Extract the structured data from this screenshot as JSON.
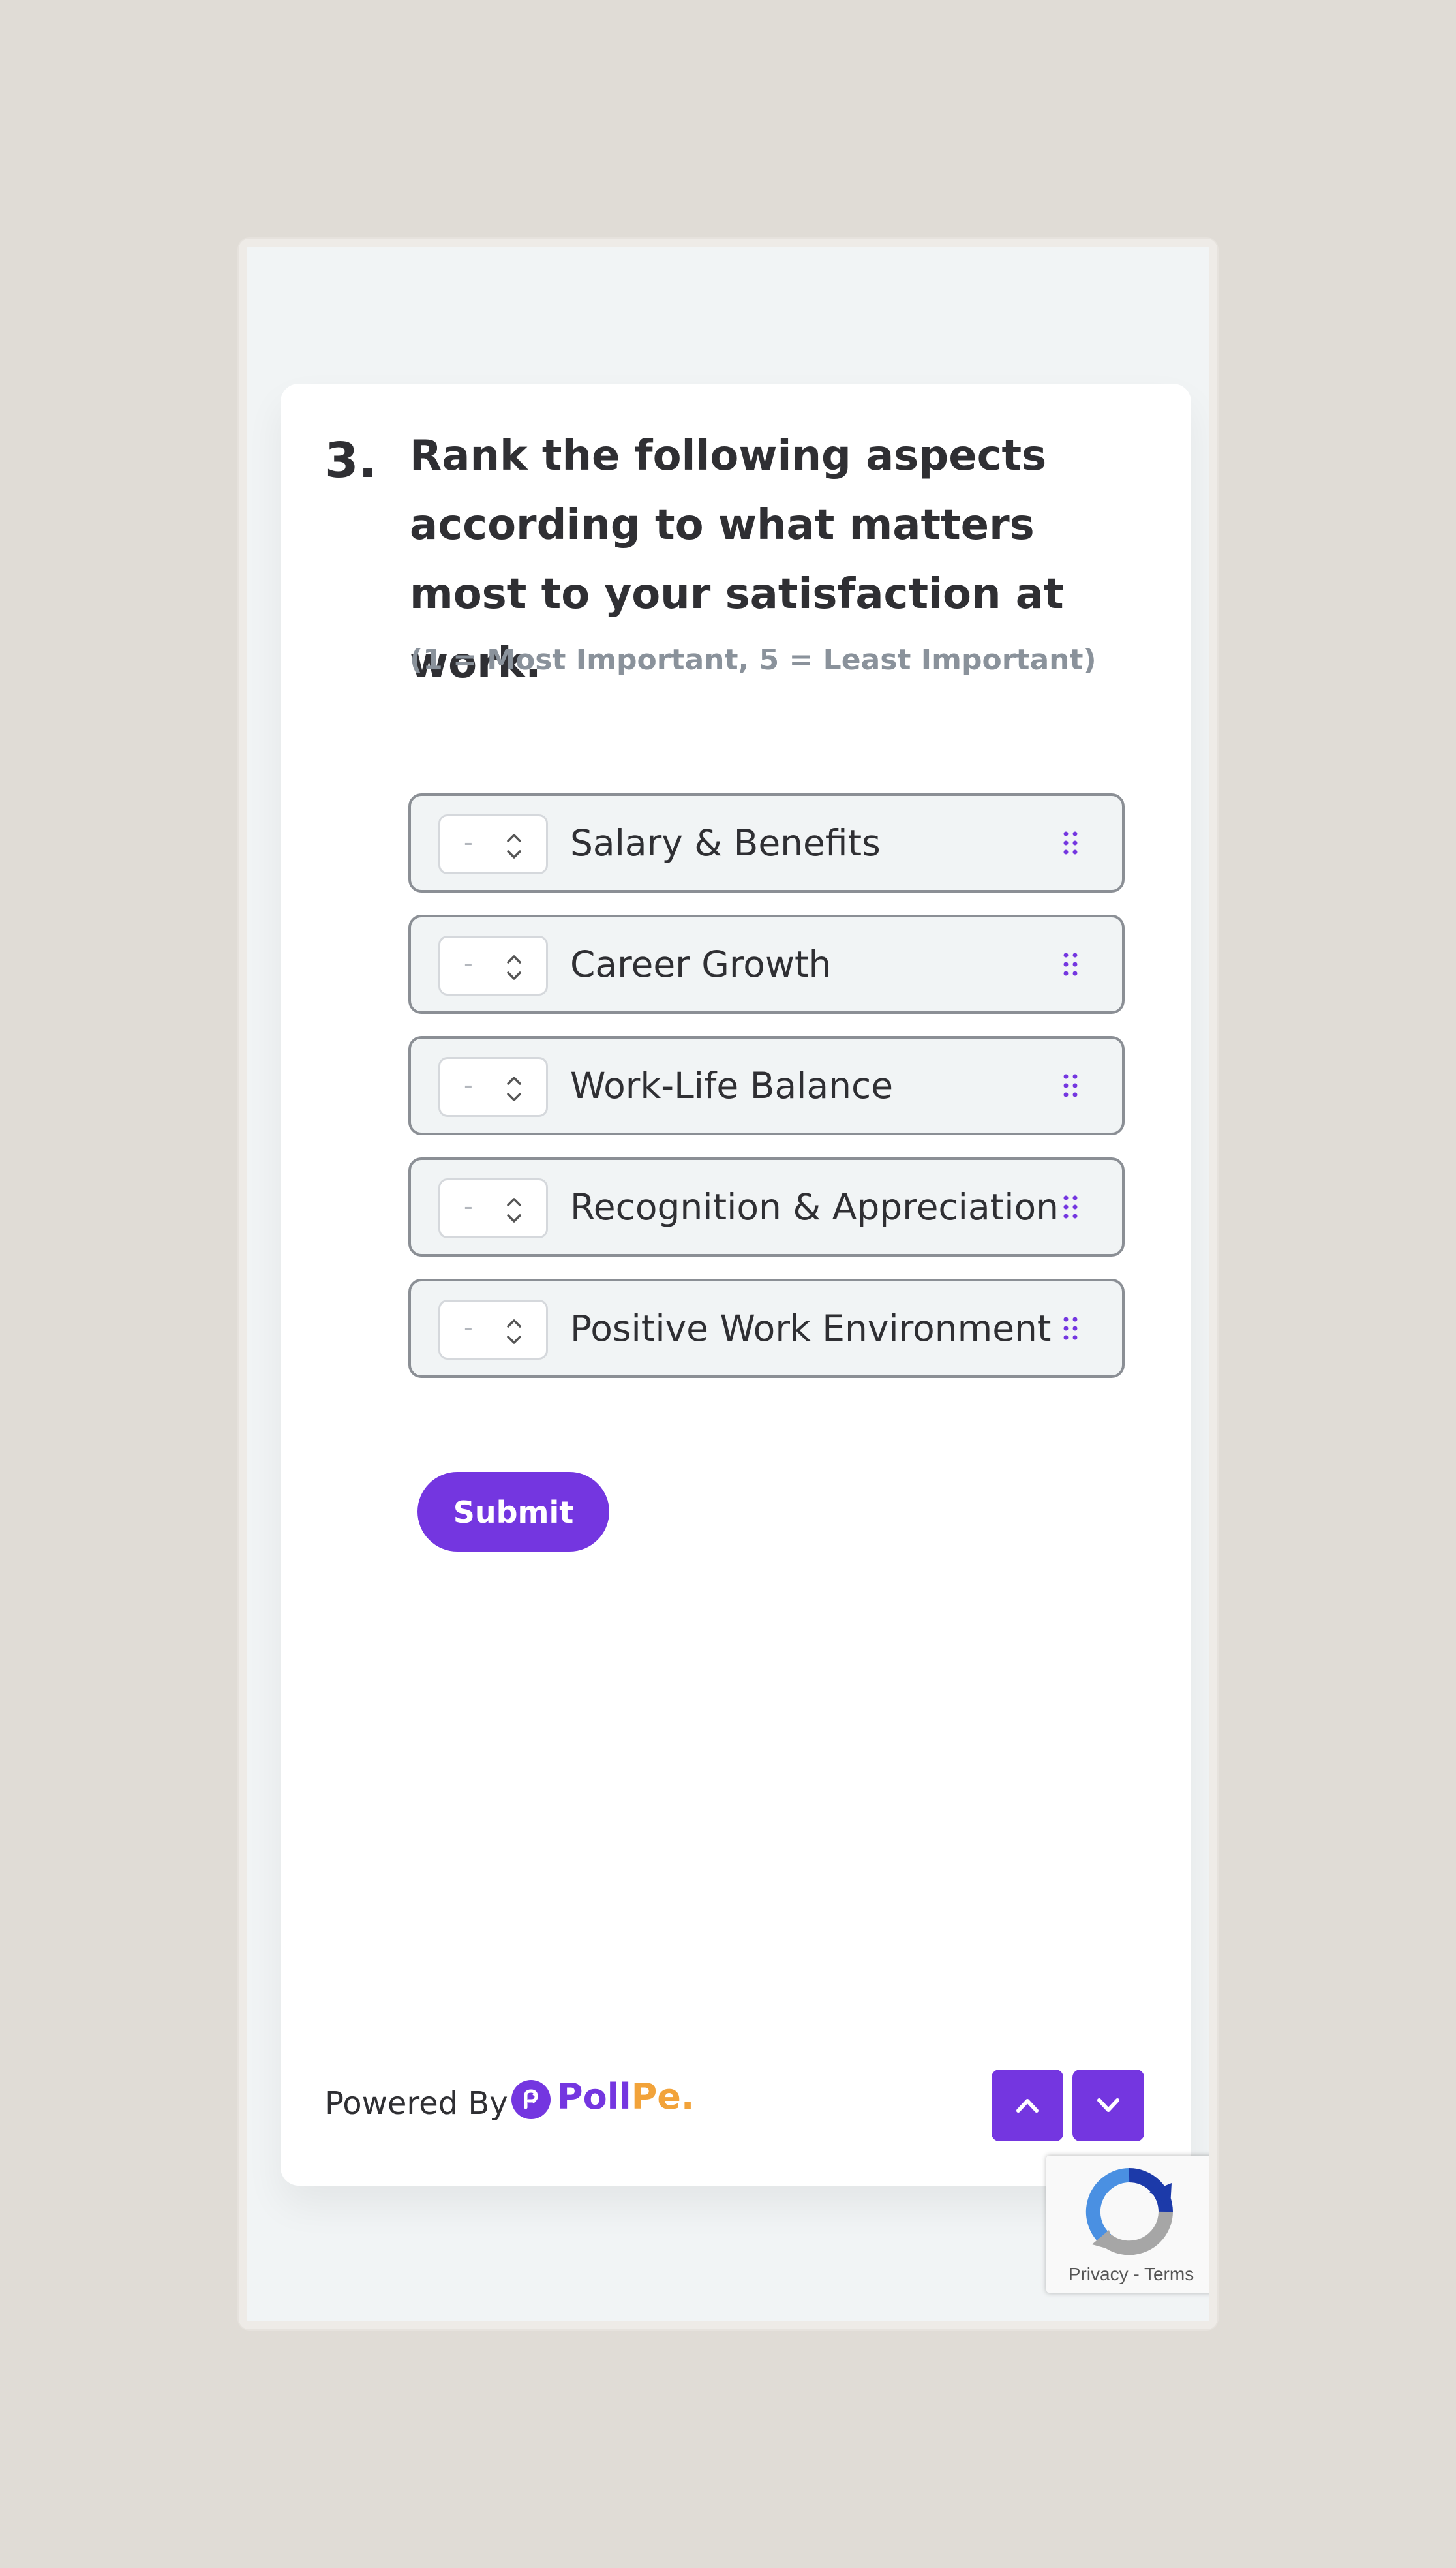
{
  "question": {
    "number": "3.",
    "title": "Rank the following aspects according to what matters most to your satisfaction at work.",
    "subtitle": "(1 = Most Important, 5 = Least Important)"
  },
  "ranking_items": [
    {
      "rank": "-",
      "label": "Salary & Benefits"
    },
    {
      "rank": "-",
      "label": "Career Growth"
    },
    {
      "rank": "-",
      "label": "Work-Life Balance"
    },
    {
      "rank": "-",
      "label": "Recognition & Appreciation"
    },
    {
      "rank": "-",
      "label": "Positive Work Environment"
    }
  ],
  "submit_label": "Submit",
  "footer": {
    "powered_by": "Powered By",
    "brand_part1": "Poll",
    "brand_part2": "Pe."
  },
  "captcha": {
    "privacy": "Privacy",
    "separator": " - ",
    "terms": "Terms"
  },
  "colors": {
    "accent": "#7436e0",
    "brand_orange": "#f2a33a",
    "text_dark": "#2f2f33",
    "text_muted": "#8a929b"
  },
  "icons": {
    "rank_spinner": "chevron-up-down-icon",
    "drag_handle": "drag-handle-icon",
    "prev": "chevron-up-icon",
    "next": "chevron-down-icon",
    "brand_logo": "pollpe-logo-icon",
    "captcha": "recaptcha-icon"
  }
}
